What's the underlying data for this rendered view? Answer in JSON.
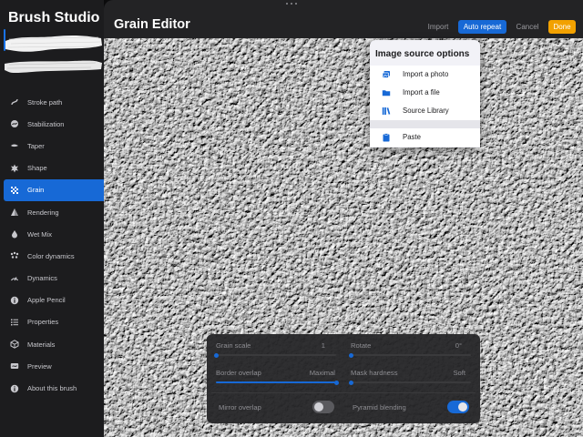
{
  "sidebar": {
    "title": "Brush Studio",
    "items": [
      {
        "label": "Stroke path",
        "icon": "stroke-path-icon"
      },
      {
        "label": "Stabilization",
        "icon": "stabilization-icon"
      },
      {
        "label": "Taper",
        "icon": "taper-icon"
      },
      {
        "label": "Shape",
        "icon": "shape-icon"
      },
      {
        "label": "Grain",
        "icon": "grain-icon",
        "active": true
      },
      {
        "label": "Rendering",
        "icon": "rendering-icon"
      },
      {
        "label": "Wet Mix",
        "icon": "wet-mix-icon"
      },
      {
        "label": "Color dynamics",
        "icon": "color-dynamics-icon"
      },
      {
        "label": "Dynamics",
        "icon": "dynamics-icon"
      },
      {
        "label": "Apple Pencil",
        "icon": "apple-pencil-icon"
      },
      {
        "label": "Properties",
        "icon": "properties-icon"
      },
      {
        "label": "Materials",
        "icon": "materials-icon"
      },
      {
        "label": "Preview",
        "icon": "preview-icon"
      },
      {
        "label": "About this brush",
        "icon": "info-icon"
      }
    ]
  },
  "editor": {
    "title": "Grain Editor",
    "import_label": "Import",
    "auto_repeat_label": "Auto repeat",
    "cancel_label": "Cancel",
    "done_label": "Done"
  },
  "popover": {
    "title": "Image source options",
    "items": [
      {
        "label": "Import a photo",
        "icon": "photos-icon"
      },
      {
        "label": "Import a file",
        "icon": "folder-icon"
      },
      {
        "label": "Source Library",
        "icon": "library-icon"
      },
      {
        "label": "Paste",
        "icon": "paste-icon"
      }
    ]
  },
  "settings": {
    "grain_scale": {
      "label": "Grain scale",
      "value": "1",
      "level": 0.0
    },
    "rotate": {
      "label": "Rotate",
      "value": "0°",
      "level": 0.0
    },
    "border_overlap": {
      "label": "Border overlap",
      "value": "Maximal",
      "level": 1.0
    },
    "mask_hardness": {
      "label": "Mask hardness",
      "value": "Soft",
      "level": 0.0
    },
    "mirror_overlap": {
      "label": "Mirror overlap",
      "on": false
    },
    "pyramid_blending": {
      "label": "Pyramid blending",
      "on": true
    }
  },
  "colors": {
    "accent": "#1769d6",
    "done": "#f2a100"
  }
}
